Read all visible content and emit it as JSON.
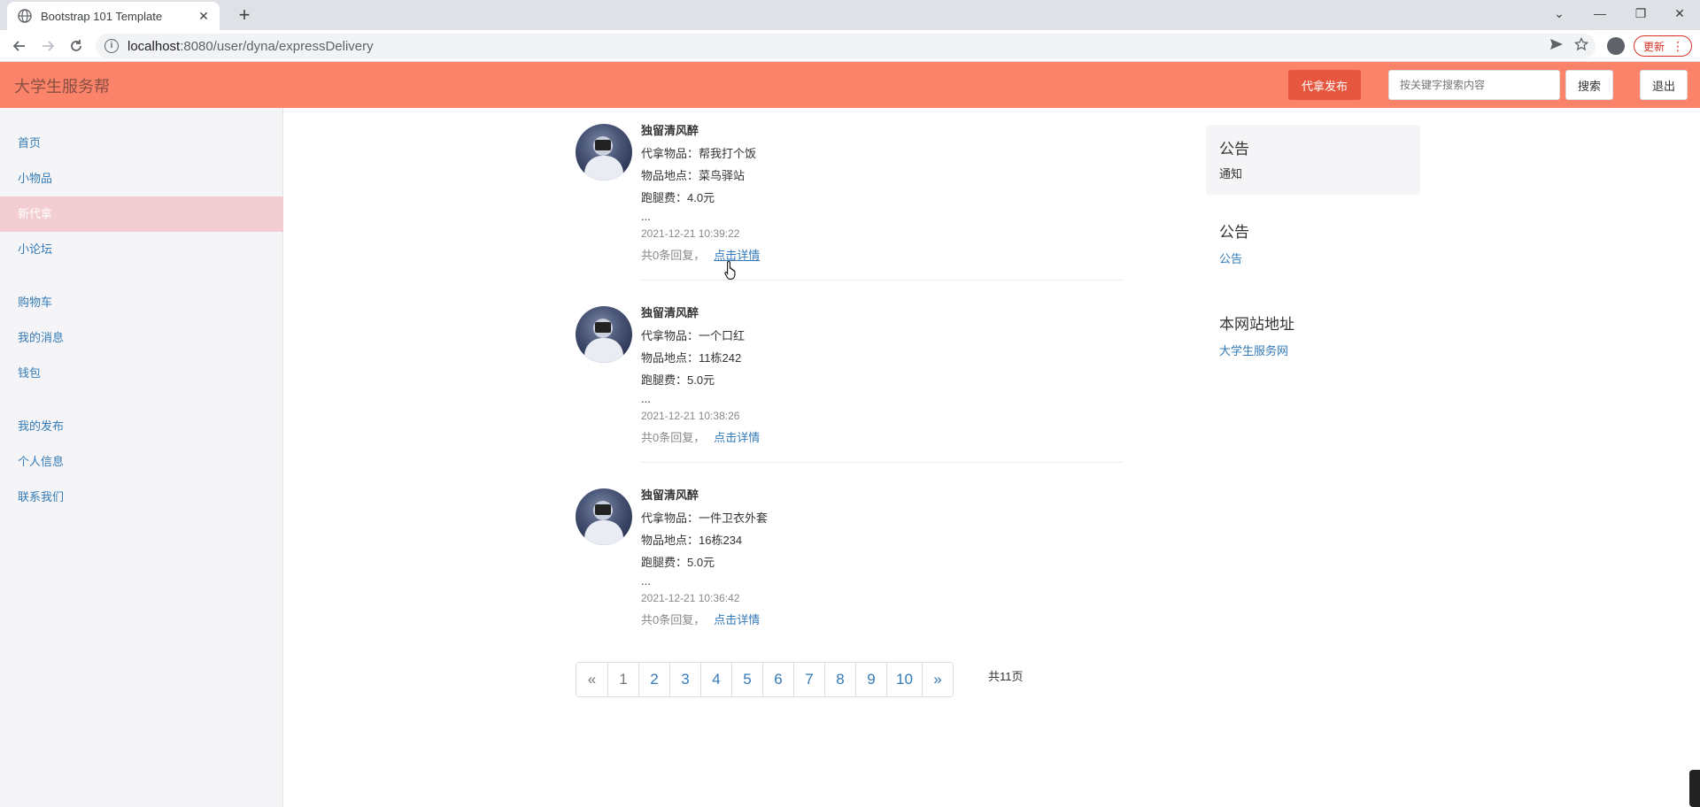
{
  "browser": {
    "tab_title": "Bootstrap 101 Template",
    "tab_close": "✕",
    "new_tab": "+",
    "url_host": "localhost",
    "url_rest": ":8080/user/dyna/expressDelivery",
    "update_label": "更新",
    "window_controls": [
      "⌄",
      "—",
      "❐",
      "✕"
    ]
  },
  "navbar": {
    "brand": "大学生服务帮",
    "publish_label": "代拿发布",
    "search_placeholder": "按关键字搜索内容",
    "search_label": "搜索",
    "logout_label": "退出",
    "brand_color": "#fa8369",
    "accent_color": "#e7573f"
  },
  "sidebar": {
    "items": [
      {
        "label": "首页",
        "active": false
      },
      {
        "label": "小物品",
        "active": false
      },
      {
        "label": "新代拿",
        "active": true
      },
      {
        "label": "小论坛",
        "active": false
      },
      {
        "label": "购物车",
        "active": false
      },
      {
        "label": "我的消息",
        "active": false
      },
      {
        "label": "钱包",
        "active": false
      },
      {
        "label": "我的发布",
        "active": false
      },
      {
        "label": "个人信息",
        "active": false
      },
      {
        "label": "联系我们",
        "active": false
      }
    ]
  },
  "posts": [
    {
      "author": "独留清风醉",
      "item": "代拿物品：帮我打个饭",
      "location": "物品地点：菜鸟驿站",
      "fee": "跑腿费：4.0元",
      "ellipsis": "...",
      "time": "2021-12-21 10:39:22",
      "replies": "共0条回复，",
      "detail_link": "点击详情"
    },
    {
      "author": "独留清风醉",
      "item": "代拿物品：一个口红",
      "location": "物品地点：11栋242",
      "fee": "跑腿费：5.0元",
      "ellipsis": "...",
      "time": "2021-12-21 10:38:26",
      "replies": "共0条回复，",
      "detail_link": "点击详情"
    },
    {
      "author": "独留清风醉",
      "item": "代拿物品：一件卫衣外套",
      "location": "物品地点：16栋234",
      "fee": "跑腿费：5.0元",
      "ellipsis": "...",
      "time": "2021-12-21 10:36:42",
      "replies": "共0条回复，",
      "detail_link": "点击详情"
    }
  ],
  "pagination": {
    "prev": "«",
    "pages": [
      "1",
      "2",
      "3",
      "4",
      "5",
      "6",
      "7",
      "8",
      "9",
      "10"
    ],
    "next": "»",
    "current": "1",
    "total": "共11页"
  },
  "right_panel": {
    "notice1_title": "公告",
    "notice1_text": "通知",
    "notice2_title": "公告",
    "notice2_link": "公告",
    "site_title": "本网站地址",
    "site_link": "大学生服务网"
  }
}
